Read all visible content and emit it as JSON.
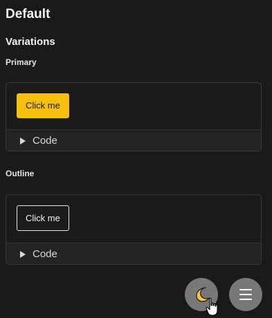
{
  "headings": {
    "default": "Default",
    "variations": "Variations",
    "primary": "Primary",
    "outline": "Outline"
  },
  "cards": {
    "primary": {
      "button_label": "Click me",
      "code_label": "Code"
    },
    "outline": {
      "button_label": "Click me",
      "code_label": "Code"
    }
  },
  "fabs": {
    "theme_icon": "moon-icon",
    "menu_icon": "menu-icon"
  },
  "colors": {
    "background": "#1a1a1a",
    "primary_button": "#f6bf0a",
    "fab": "#787878"
  }
}
